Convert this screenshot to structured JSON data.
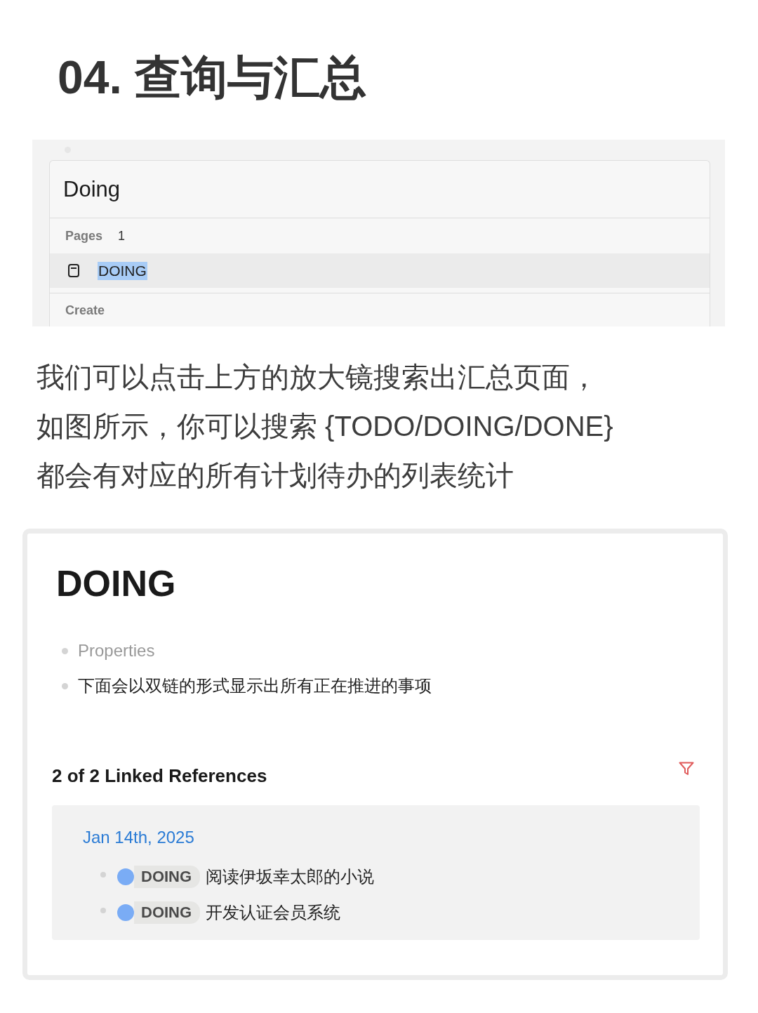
{
  "heading": "04. 查询与汇总",
  "search_screenshot": {
    "query": "Doing",
    "groups": [
      {
        "label": "Pages",
        "count": "1",
        "results": [
          {
            "title": "DOING",
            "selected": true
          }
        ]
      }
    ],
    "footer_label": "Create"
  },
  "description": {
    "lines": [
      "我们可以点击上方的放大镜搜索出汇总页面，",
      "如图所示，你可以搜索 {TODO/DOING/DONE}",
      "都会有对应的所有计划待办的列表统计"
    ]
  },
  "page": {
    "title": "DOING",
    "blocks": [
      {
        "kind": "property",
        "text": "Properties"
      },
      {
        "kind": "text",
        "text": "下面会以双链的形式显示出所有正在推进的事项"
      }
    ],
    "linked_references": {
      "title": "2 of 2 Linked References",
      "groups": [
        {
          "date": "Jan 14th, 2025",
          "items": [
            {
              "marker": "DOING",
              "text": "阅读伊坂幸太郎的小说"
            },
            {
              "marker": "DOING",
              "text": "开发认证会员系统"
            }
          ]
        }
      ]
    }
  }
}
